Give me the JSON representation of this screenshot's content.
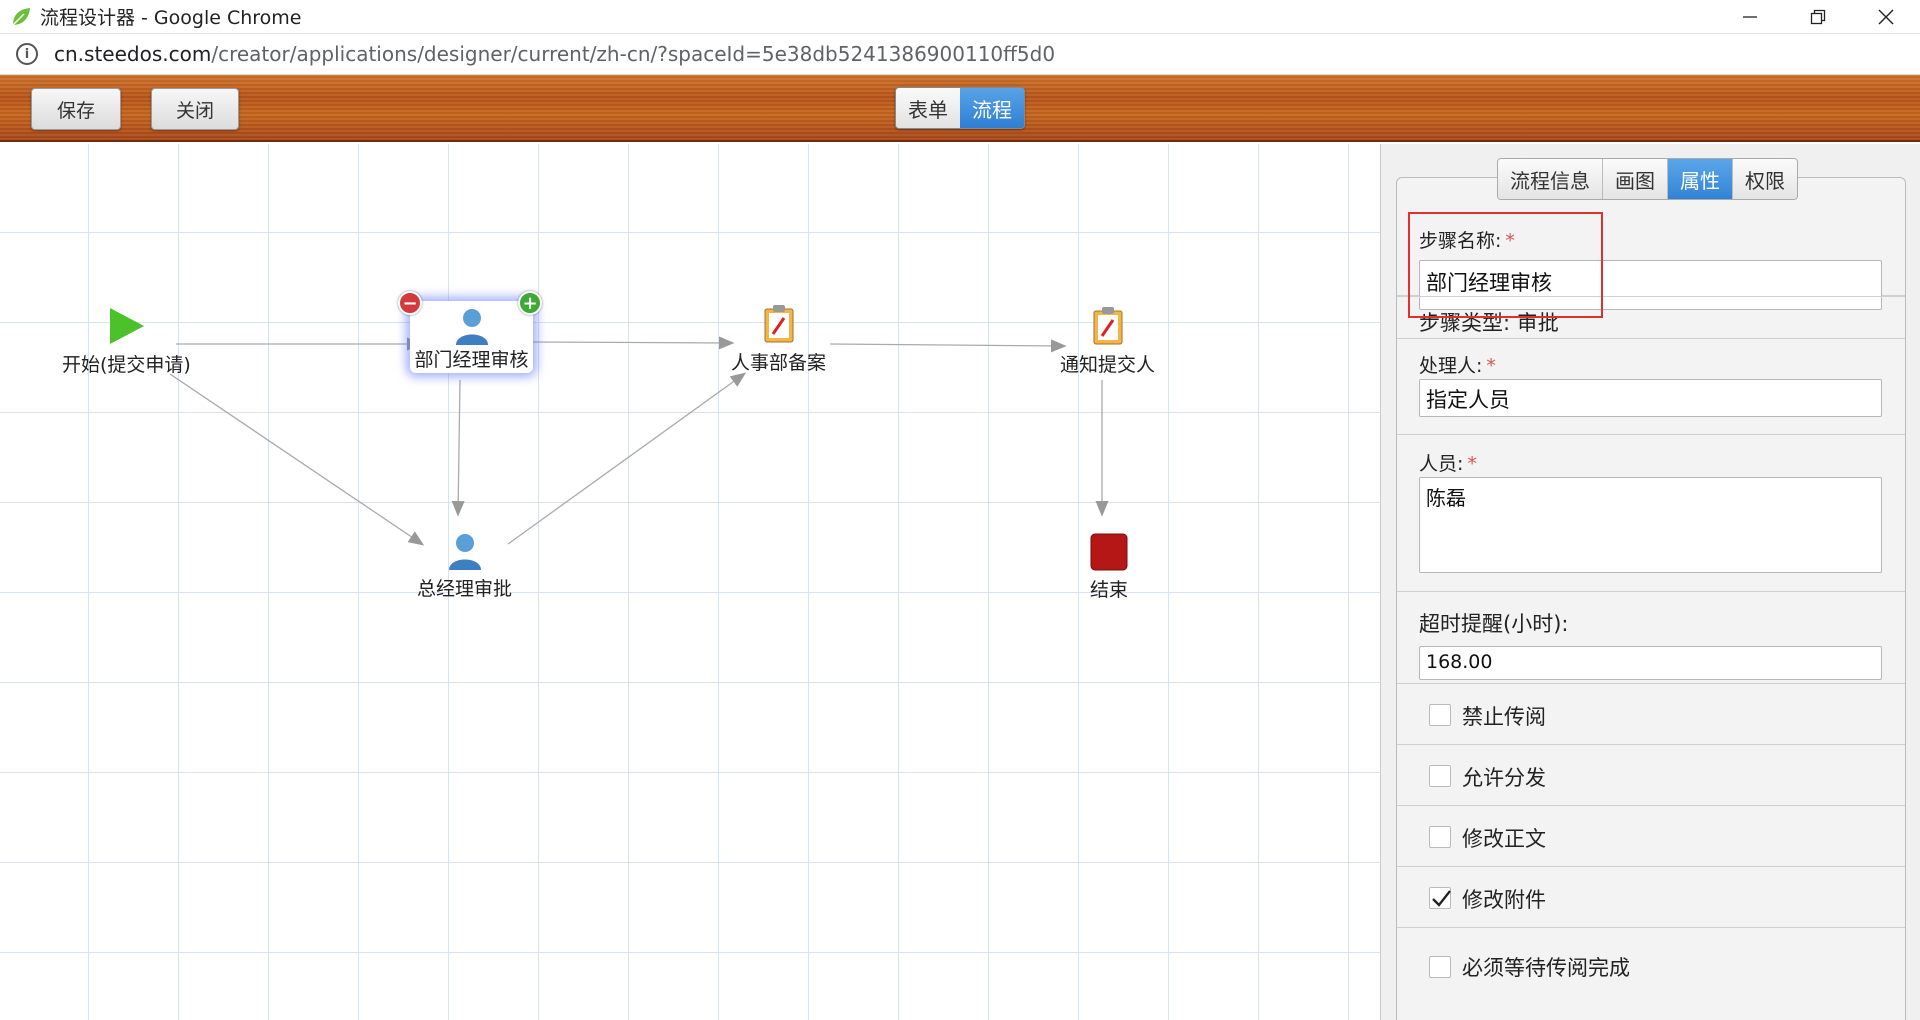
{
  "window": {
    "title": "流程设计器 - Google Chrome"
  },
  "address": {
    "host": "cn.steedos.com",
    "path": "/creator/applications/designer/current/zh-cn/?spaceId=5e38db5241386900110ff5d0"
  },
  "toolbar": {
    "save_label": "保存",
    "close_label": "关闭",
    "mode_form": "表单",
    "mode_flow": "流程",
    "active_mode": "流程"
  },
  "canvas": {
    "nodes": {
      "start": "开始(提交申请)",
      "dept_manager": "部门经理审核",
      "hr_record": "人事部备案",
      "notify": "通知提交人",
      "gm_approve": "总经理审批",
      "end": "结束"
    }
  },
  "panel": {
    "tabs": [
      "流程信息",
      "画图",
      "属性",
      "权限"
    ],
    "active_tab": "属性",
    "step_name_label": "步骤名称:",
    "step_name_value": "部门经理审核",
    "step_type_label": "步骤类型: 审批",
    "handler_label": "处理人:",
    "handler_value": "指定人员",
    "people_label": "人员:",
    "people_value": "陈磊",
    "timeout_label": "超时提醒(小时):",
    "timeout_value": "168.00",
    "checks": [
      {
        "label": "禁止传阅",
        "checked": false
      },
      {
        "label": "允许分发",
        "checked": false
      },
      {
        "label": "修改正文",
        "checked": false
      },
      {
        "label": "修改附件",
        "checked": true
      },
      {
        "label": "必须等待传阅完成",
        "checked": false
      }
    ]
  },
  "colors": {
    "accent": "#3484d6",
    "highlight": "#e03030"
  }
}
